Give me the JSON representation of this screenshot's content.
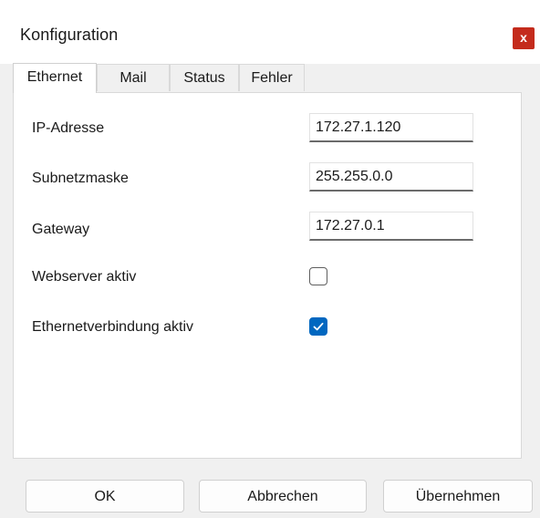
{
  "window": {
    "title": "Konfiguration",
    "close_label": "x",
    "accent_color": "#0067c0",
    "close_color": "#c42b1c"
  },
  "tabs": [
    {
      "label": "Ethernet",
      "active": true
    },
    {
      "label": "Mail",
      "active": false
    },
    {
      "label": "Status",
      "active": false
    },
    {
      "label": "Fehler",
      "active": false
    }
  ],
  "ethernet": {
    "ip_label": "IP-Adresse",
    "ip_value": "172.27.1.120",
    "subnet_label": "Subnetzmaske",
    "subnet_value": "255.255.0.0",
    "gateway_label": "Gateway",
    "gateway_value": "172.27.0.1",
    "webserver_label": "Webserver aktiv",
    "webserver_checked": false,
    "ethernet_label": "Ethernetverbindung aktiv",
    "ethernet_checked": true
  },
  "buttons": {
    "ok": "OK",
    "cancel": "Abbrechen",
    "apply": "Übernehmen"
  }
}
